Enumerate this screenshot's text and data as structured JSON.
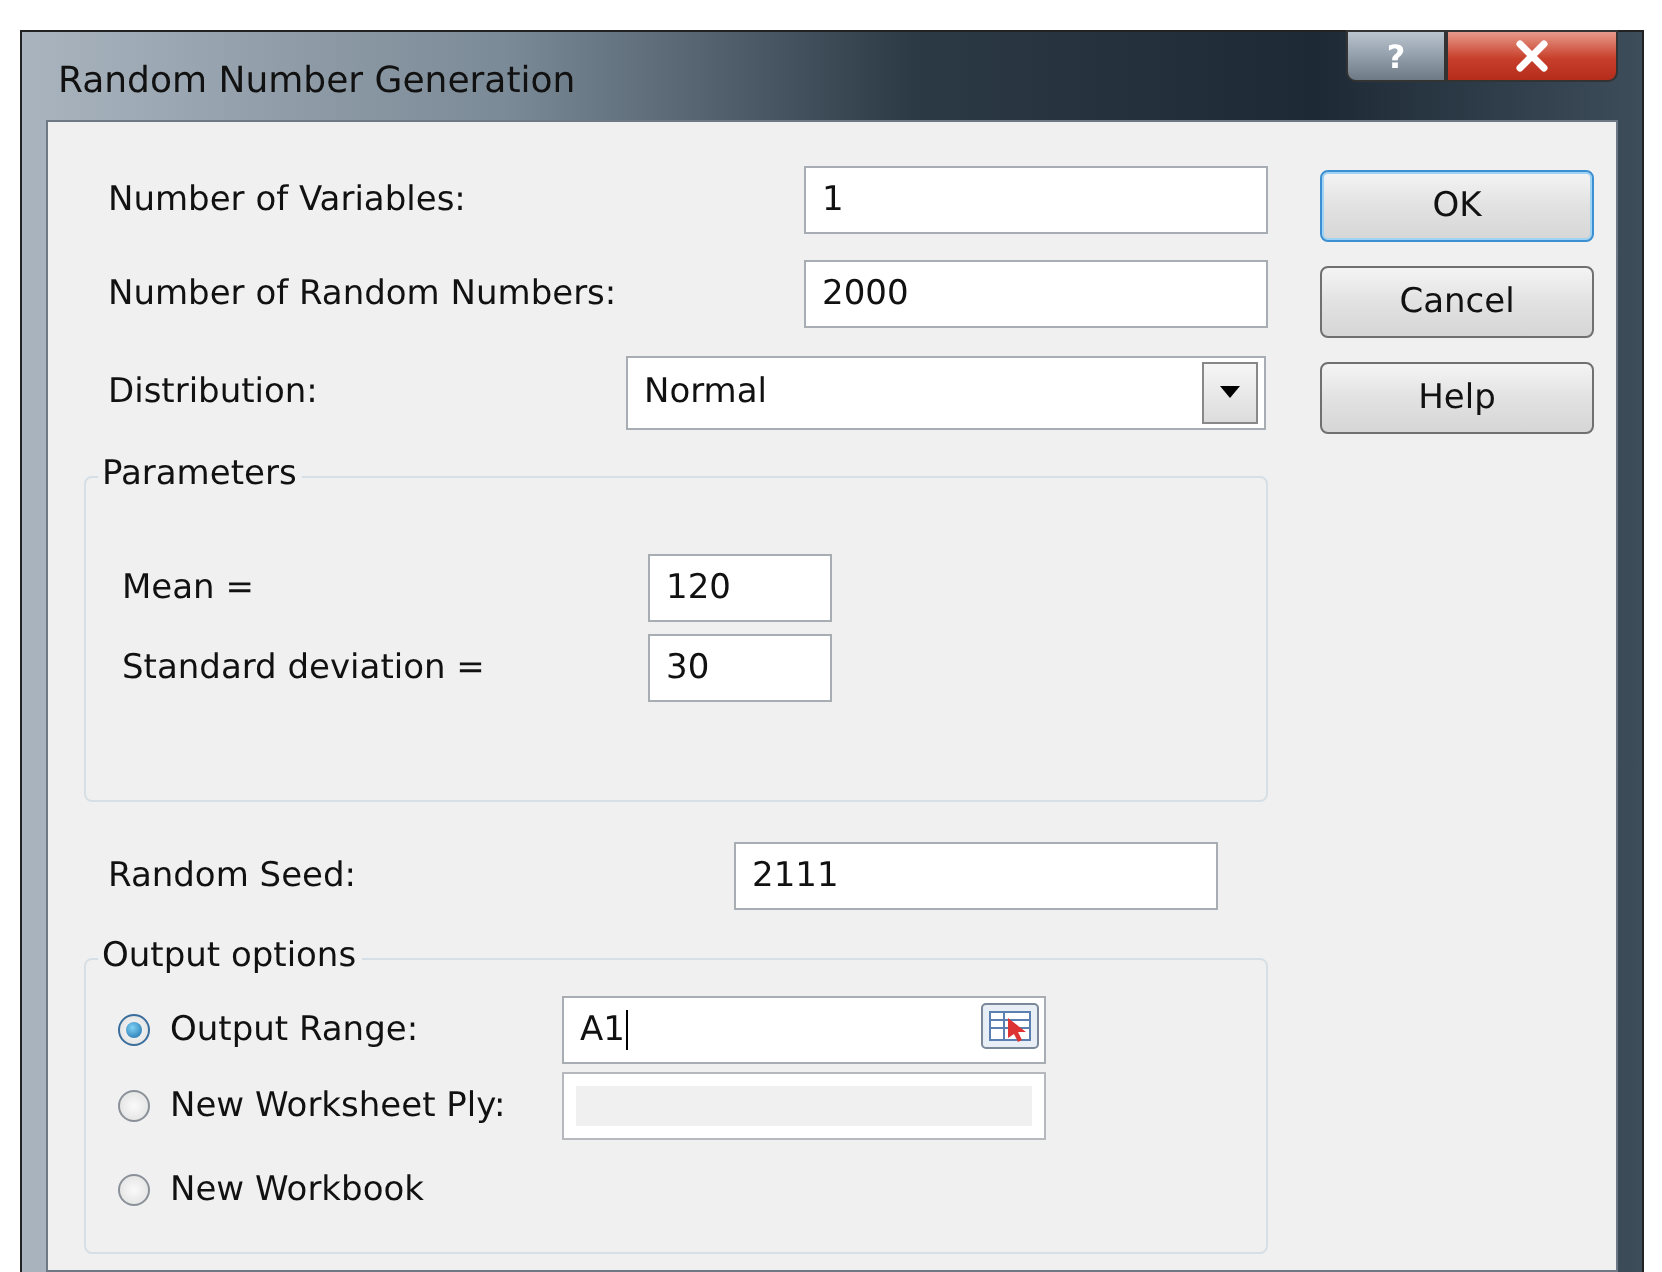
{
  "window": {
    "title": "Random Number Generation",
    "help_button": "?"
  },
  "fields": [
    {
      "label": "Number of Variables:",
      "value": "1"
    },
    {
      "label": "Number of Random Numbers:",
      "value": "2000"
    }
  ],
  "distribution": {
    "label": "Distribution:",
    "value": "Normal"
  },
  "buttons": [
    {
      "label": "OK",
      "default": true
    },
    {
      "label": "Cancel",
      "default": false
    },
    {
      "label": "Help",
      "default": false
    }
  ],
  "parameters": {
    "title": "Parameters",
    "fields": [
      {
        "label": "Mean =",
        "value": "120"
      },
      {
        "label": "Standard deviation =",
        "value": "30"
      }
    ]
  },
  "random_seed": {
    "label": "Random Seed:",
    "value": "2111"
  },
  "output_options": {
    "title": "Output options",
    "options": [
      {
        "label": "Output Range:",
        "selected": true,
        "field": {
          "value": "A1",
          "focused": true,
          "disabled": false
        }
      },
      {
        "label": "New Worksheet Ply:",
        "selected": false,
        "field": {
          "disabled": true
        }
      },
      {
        "label": "New Workbook",
        "selected": false
      }
    ]
  }
}
